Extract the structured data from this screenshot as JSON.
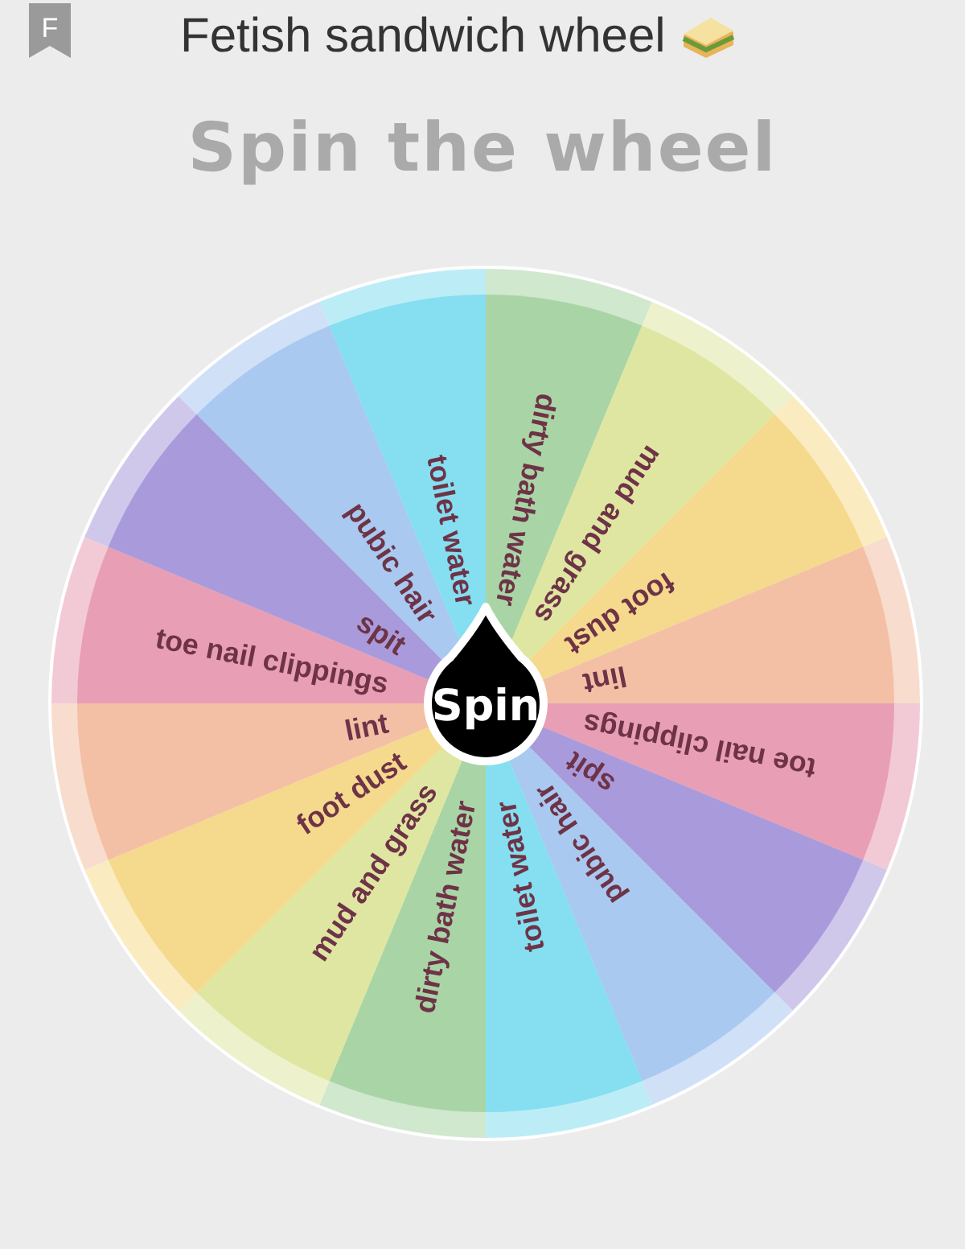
{
  "header": {
    "badge_letter": "F",
    "title": "Fetish sandwich wheel"
  },
  "heading": "Spin the wheel",
  "wheel": {
    "button": "Spin",
    "segments": [
      {
        "label": "dirty bath water",
        "color": "#a9d5a6"
      },
      {
        "label": "mud and grass",
        "color": "#dfe6a2"
      },
      {
        "label": "foot dust",
        "color": "#f5da8e"
      },
      {
        "label": "lint",
        "color": "#f3c0a6"
      },
      {
        "label": "toe nail clippings",
        "color": "#e89fb5"
      },
      {
        "label": "spit",
        "color": "#a99bdb"
      },
      {
        "label": "pubic hair",
        "color": "#a9c9f0"
      },
      {
        "label": "toilet water",
        "color": "#85dff0"
      },
      {
        "label": "dirty bath water",
        "color": "#a9d5a6"
      },
      {
        "label": "mud and grass",
        "color": "#dfe6a2"
      },
      {
        "label": "foot dust",
        "color": "#f5da8e"
      },
      {
        "label": "lint",
        "color": "#f3c0a6"
      },
      {
        "label": "toe nail clippings",
        "color": "#e89fb5"
      },
      {
        "label": "spit",
        "color": "#a99bdb"
      },
      {
        "label": "pubic hair",
        "color": "#a9c9f0"
      },
      {
        "label": "toilet water",
        "color": "#85dff0"
      }
    ]
  }
}
